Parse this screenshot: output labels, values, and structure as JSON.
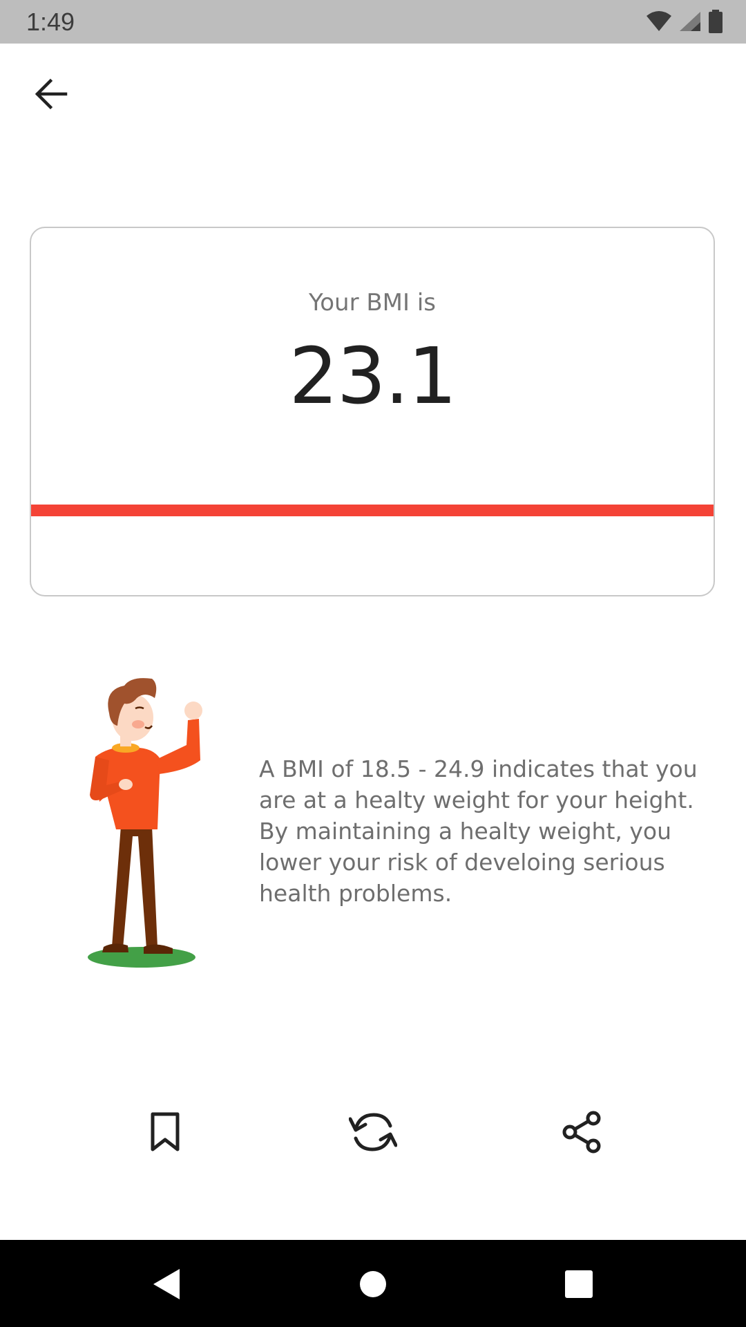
{
  "status_bar": {
    "time": "1:49",
    "icons": [
      "wifi-icon",
      "cell-signal-icon",
      "battery-icon"
    ]
  },
  "header": {
    "back_icon": "arrow-left-icon"
  },
  "result": {
    "label": "Your BMI is",
    "value": "23.1",
    "bar_color": "#f44336"
  },
  "description": {
    "text": "A BMI of 18.5 - 24.9 indicates that you are at a healty weight for your height. By maintaining a healty weight, you lower your risk of develoing serious health problems.",
    "illustration": "healthy-man-illustration"
  },
  "actions": {
    "bookmark_icon": "bookmark-icon",
    "refresh_icon": "refresh-icon",
    "share_icon": "share-icon"
  },
  "nav_bar": {
    "buttons": [
      "nav-back-icon",
      "nav-home-icon",
      "nav-recents-icon"
    ]
  },
  "colors": {
    "accent": "#f44336",
    "shirt": "#f4511e",
    "pants": "#6d2f0a",
    "ground": "#43a047"
  }
}
